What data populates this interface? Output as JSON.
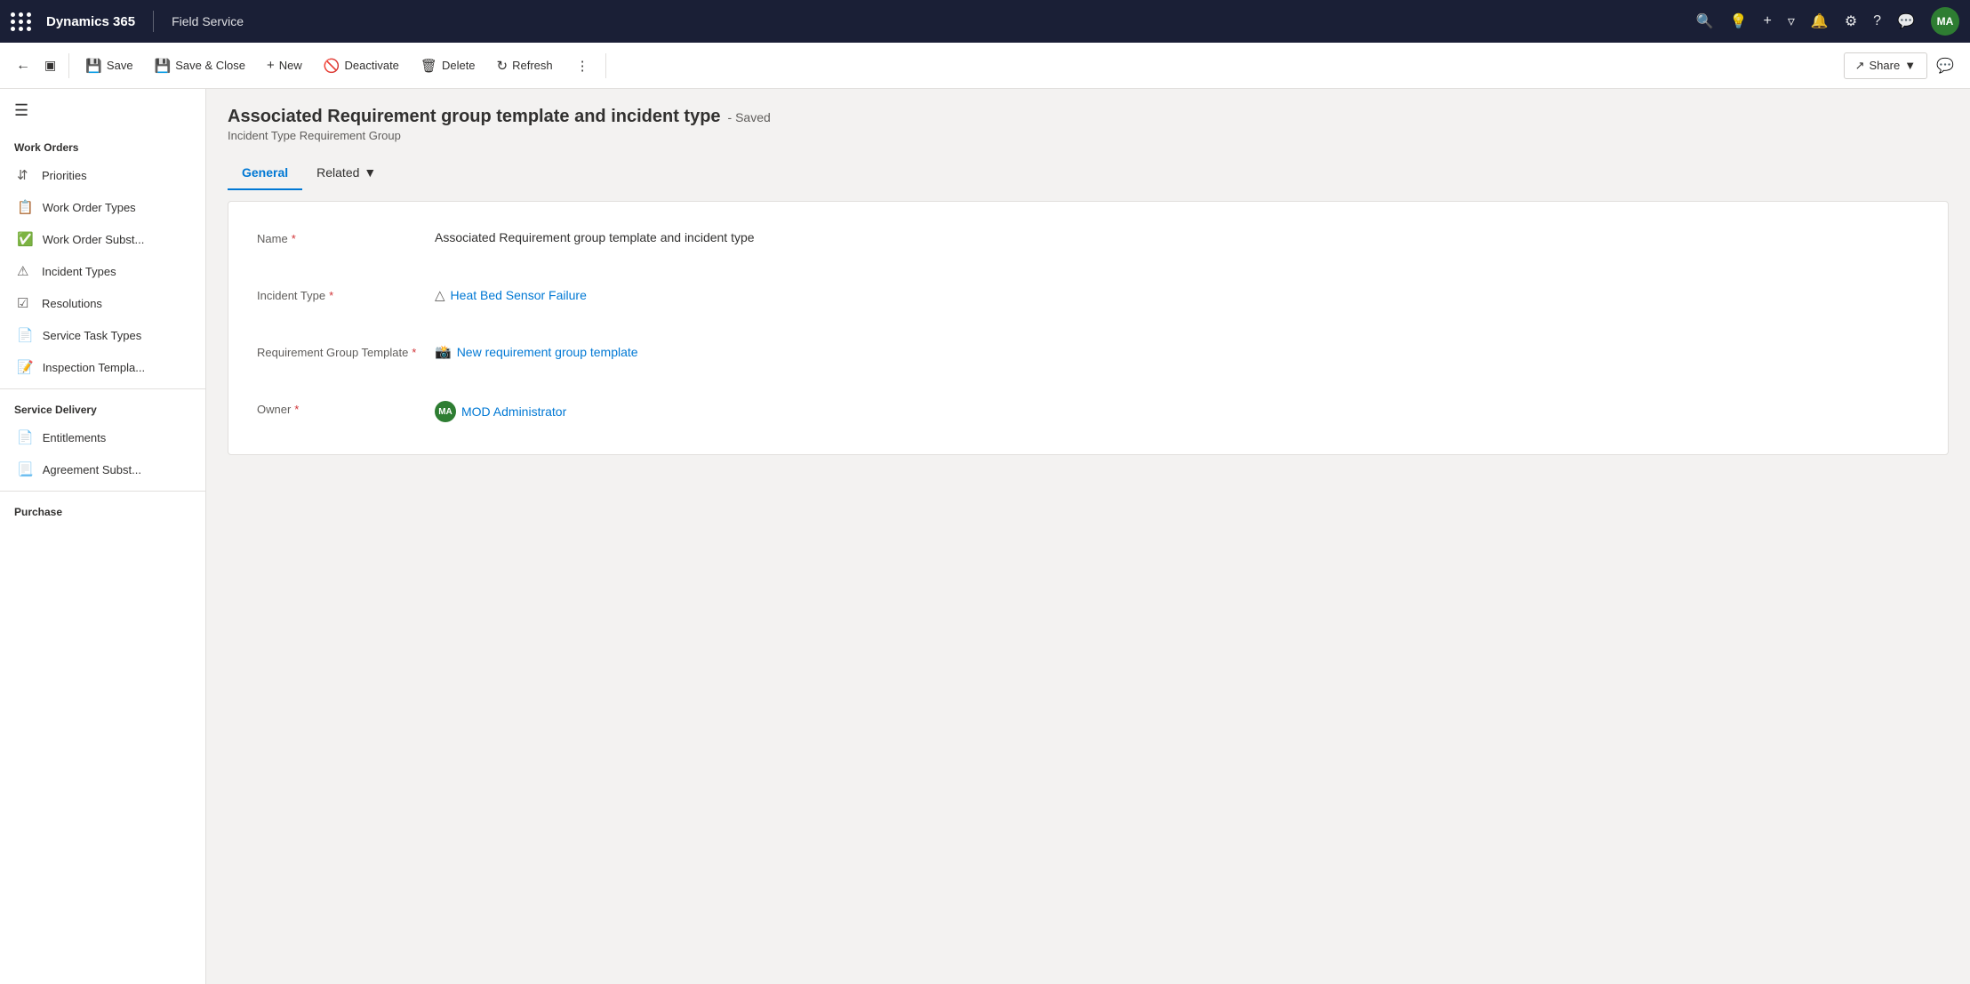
{
  "topbar": {
    "app_dots": "dots",
    "title": "Dynamics 365",
    "separator": "|",
    "app_name": "Field Service",
    "avatar_initials": "MA"
  },
  "commandbar": {
    "save_label": "Save",
    "save_close_label": "Save & Close",
    "new_label": "New",
    "deactivate_label": "Deactivate",
    "delete_label": "Delete",
    "refresh_label": "Refresh",
    "share_label": "Share"
  },
  "record": {
    "title": "Associated Requirement group template and incident type",
    "saved_status": "- Saved",
    "subtitle": "Incident Type Requirement Group"
  },
  "tabs": [
    {
      "label": "General",
      "active": true
    },
    {
      "label": "Related",
      "active": false,
      "has_chevron": true
    }
  ],
  "form": {
    "fields": [
      {
        "label": "Name",
        "required": true,
        "value_text": "Associated Requirement group template and incident type",
        "type": "text"
      },
      {
        "label": "Incident Type",
        "required": true,
        "value_link": "Heat Bed Sensor Failure",
        "icon": "warning",
        "type": "link"
      },
      {
        "label": "Requirement Group Template",
        "required": true,
        "value_link": "New requirement group template",
        "icon": "template",
        "type": "link"
      },
      {
        "label": "Owner",
        "required": true,
        "value_link": "MOD Administrator",
        "avatar_initials": "MA",
        "type": "owner"
      }
    ]
  },
  "sidebar": {
    "section_work_orders": "Work Orders",
    "section_service_delivery": "Service Delivery",
    "section_purchase": "Purchase",
    "items_work_orders": [
      {
        "label": "Priorities",
        "icon": "sort"
      },
      {
        "label": "Work Order Types",
        "icon": "clipboard"
      },
      {
        "label": "Work Order Subst...",
        "icon": "clipboard-check"
      },
      {
        "label": "Incident Types",
        "icon": "warning-nav"
      },
      {
        "label": "Resolutions",
        "icon": "check-circle"
      },
      {
        "label": "Service Task Types",
        "icon": "task"
      },
      {
        "label": "Inspection Templa...",
        "icon": "inspection"
      }
    ],
    "items_service_delivery": [
      {
        "label": "Entitlements",
        "icon": "entitlement"
      },
      {
        "label": "Agreement Subst...",
        "icon": "agreement"
      }
    ]
  }
}
